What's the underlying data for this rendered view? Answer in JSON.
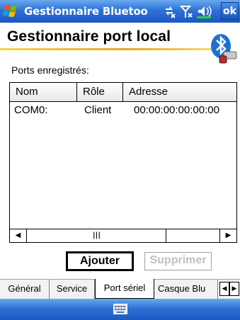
{
  "titlebar": {
    "title": "Gestionnaire Bluetoo",
    "ok_label": "ok",
    "icons": [
      "start-flag-icon",
      "connectivity-icon",
      "signal-icon",
      "volume-icon"
    ]
  },
  "header": {
    "title": "Gestionnaire port local",
    "logo": "bluetooth-port-icon"
  },
  "ports": {
    "label": "Ports enregistrés:",
    "columns": [
      "Nom",
      "Rôle",
      "Adresse"
    ],
    "rows": [
      {
        "nom": "COM0:",
        "role": "Client",
        "adresse": "00:00:00:00:00:00"
      }
    ]
  },
  "buttons": {
    "add": "Ajouter",
    "delete": "Supprimer"
  },
  "tabs": [
    {
      "label": "Général",
      "active": false
    },
    {
      "label": "Service",
      "active": false
    },
    {
      "label": "Port sériel",
      "active": true
    },
    {
      "label": "Casque Blu",
      "active": false
    }
  ],
  "colors": {
    "titlebar": "#2e72d6",
    "header_rule": "#e9a81d",
    "disabled_text": "#c0c0c0"
  },
  "bottombar": {
    "icon": "keyboard-icon"
  }
}
